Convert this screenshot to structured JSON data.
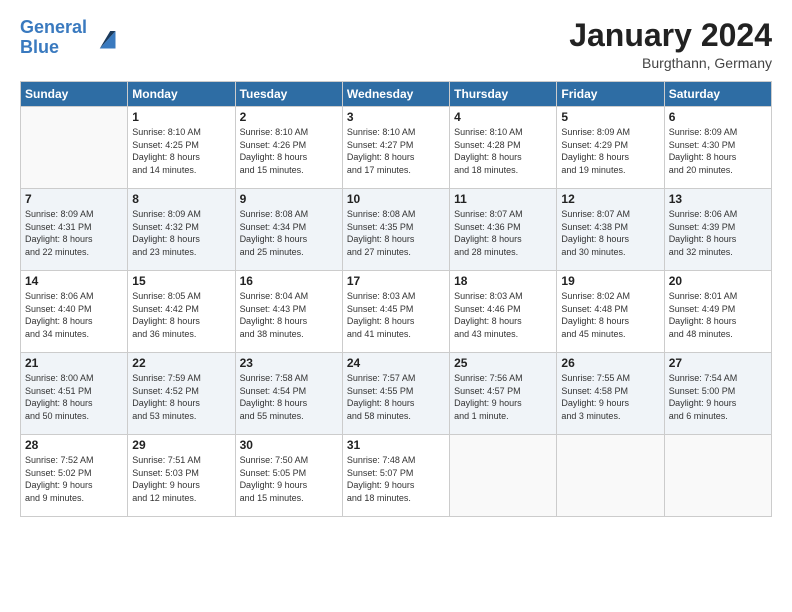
{
  "logo": {
    "line1": "General",
    "line2": "Blue"
  },
  "title": "January 2024",
  "location": "Burgthann, Germany",
  "weekdays": [
    "Sunday",
    "Monday",
    "Tuesday",
    "Wednesday",
    "Thursday",
    "Friday",
    "Saturday"
  ],
  "weeks": [
    [
      {
        "day": "",
        "info": ""
      },
      {
        "day": "1",
        "info": "Sunrise: 8:10 AM\nSunset: 4:25 PM\nDaylight: 8 hours\nand 14 minutes."
      },
      {
        "day": "2",
        "info": "Sunrise: 8:10 AM\nSunset: 4:26 PM\nDaylight: 8 hours\nand 15 minutes."
      },
      {
        "day": "3",
        "info": "Sunrise: 8:10 AM\nSunset: 4:27 PM\nDaylight: 8 hours\nand 17 minutes."
      },
      {
        "day": "4",
        "info": "Sunrise: 8:10 AM\nSunset: 4:28 PM\nDaylight: 8 hours\nand 18 minutes."
      },
      {
        "day": "5",
        "info": "Sunrise: 8:09 AM\nSunset: 4:29 PM\nDaylight: 8 hours\nand 19 minutes."
      },
      {
        "day": "6",
        "info": "Sunrise: 8:09 AM\nSunset: 4:30 PM\nDaylight: 8 hours\nand 20 minutes."
      }
    ],
    [
      {
        "day": "7",
        "info": "Sunrise: 8:09 AM\nSunset: 4:31 PM\nDaylight: 8 hours\nand 22 minutes."
      },
      {
        "day": "8",
        "info": "Sunrise: 8:09 AM\nSunset: 4:32 PM\nDaylight: 8 hours\nand 23 minutes."
      },
      {
        "day": "9",
        "info": "Sunrise: 8:08 AM\nSunset: 4:34 PM\nDaylight: 8 hours\nand 25 minutes."
      },
      {
        "day": "10",
        "info": "Sunrise: 8:08 AM\nSunset: 4:35 PM\nDaylight: 8 hours\nand 27 minutes."
      },
      {
        "day": "11",
        "info": "Sunrise: 8:07 AM\nSunset: 4:36 PM\nDaylight: 8 hours\nand 28 minutes."
      },
      {
        "day": "12",
        "info": "Sunrise: 8:07 AM\nSunset: 4:38 PM\nDaylight: 8 hours\nand 30 minutes."
      },
      {
        "day": "13",
        "info": "Sunrise: 8:06 AM\nSunset: 4:39 PM\nDaylight: 8 hours\nand 32 minutes."
      }
    ],
    [
      {
        "day": "14",
        "info": "Sunrise: 8:06 AM\nSunset: 4:40 PM\nDaylight: 8 hours\nand 34 minutes."
      },
      {
        "day": "15",
        "info": "Sunrise: 8:05 AM\nSunset: 4:42 PM\nDaylight: 8 hours\nand 36 minutes."
      },
      {
        "day": "16",
        "info": "Sunrise: 8:04 AM\nSunset: 4:43 PM\nDaylight: 8 hours\nand 38 minutes."
      },
      {
        "day": "17",
        "info": "Sunrise: 8:03 AM\nSunset: 4:45 PM\nDaylight: 8 hours\nand 41 minutes."
      },
      {
        "day": "18",
        "info": "Sunrise: 8:03 AM\nSunset: 4:46 PM\nDaylight: 8 hours\nand 43 minutes."
      },
      {
        "day": "19",
        "info": "Sunrise: 8:02 AM\nSunset: 4:48 PM\nDaylight: 8 hours\nand 45 minutes."
      },
      {
        "day": "20",
        "info": "Sunrise: 8:01 AM\nSunset: 4:49 PM\nDaylight: 8 hours\nand 48 minutes."
      }
    ],
    [
      {
        "day": "21",
        "info": "Sunrise: 8:00 AM\nSunset: 4:51 PM\nDaylight: 8 hours\nand 50 minutes."
      },
      {
        "day": "22",
        "info": "Sunrise: 7:59 AM\nSunset: 4:52 PM\nDaylight: 8 hours\nand 53 minutes."
      },
      {
        "day": "23",
        "info": "Sunrise: 7:58 AM\nSunset: 4:54 PM\nDaylight: 8 hours\nand 55 minutes."
      },
      {
        "day": "24",
        "info": "Sunrise: 7:57 AM\nSunset: 4:55 PM\nDaylight: 8 hours\nand 58 minutes."
      },
      {
        "day": "25",
        "info": "Sunrise: 7:56 AM\nSunset: 4:57 PM\nDaylight: 9 hours\nand 1 minute."
      },
      {
        "day": "26",
        "info": "Sunrise: 7:55 AM\nSunset: 4:58 PM\nDaylight: 9 hours\nand 3 minutes."
      },
      {
        "day": "27",
        "info": "Sunrise: 7:54 AM\nSunset: 5:00 PM\nDaylight: 9 hours\nand 6 minutes."
      }
    ],
    [
      {
        "day": "28",
        "info": "Sunrise: 7:52 AM\nSunset: 5:02 PM\nDaylight: 9 hours\nand 9 minutes."
      },
      {
        "day": "29",
        "info": "Sunrise: 7:51 AM\nSunset: 5:03 PM\nDaylight: 9 hours\nand 12 minutes."
      },
      {
        "day": "30",
        "info": "Sunrise: 7:50 AM\nSunset: 5:05 PM\nDaylight: 9 hours\nand 15 minutes."
      },
      {
        "day": "31",
        "info": "Sunrise: 7:48 AM\nSunset: 5:07 PM\nDaylight: 9 hours\nand 18 minutes."
      },
      {
        "day": "",
        "info": ""
      },
      {
        "day": "",
        "info": ""
      },
      {
        "day": "",
        "info": ""
      }
    ]
  ]
}
